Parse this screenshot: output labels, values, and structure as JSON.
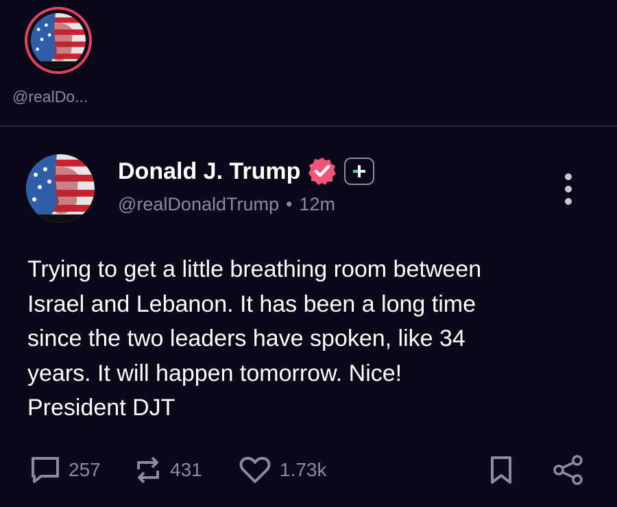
{
  "story": {
    "handle": "@realDo..."
  },
  "post": {
    "author_name": "Donald J. Trump",
    "handle": "@realDonaldTrump",
    "separator": "•",
    "time": "12m",
    "body": "Trying to get a little breathing room between\nIsrael and Lebanon. It has been a long time\nsince the two leaders have spoken, like 34\nyears. It will happen tomorrow. Nice!\nPresident DJT"
  },
  "actions": {
    "replies": "257",
    "reposts": "431",
    "likes": "1.73k"
  },
  "colors": {
    "background": "#0b0819",
    "story_ring": "#e0435f",
    "verified_badge": "#f2557a",
    "muted_text": "#8d8a99",
    "plus_accent": "#48d8c8"
  },
  "icons": [
    "verified-badge-icon",
    "plus-badge-icon",
    "more-options-icon",
    "reply-icon",
    "repost-icon",
    "like-icon",
    "bookmark-icon",
    "share-icon"
  ]
}
